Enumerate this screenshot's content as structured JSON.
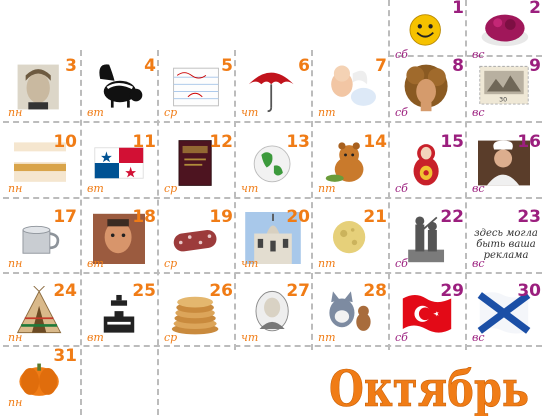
{
  "month": {
    "title": "Октябрь",
    "color": "#f07c16"
  },
  "colors": {
    "weekday": "#f07c16",
    "weekend": "#9b1f7e",
    "grid": "#bcbcbc"
  },
  "ad_text": "здесь могла быть ваша реклама",
  "days": [
    {
      "day": "1",
      "dow": "сб",
      "icon": "smiley-icon"
    },
    {
      "day": "2",
      "dow": "вс",
      "icon": "beet-salad-icon"
    },
    {
      "day": "3",
      "dow": "пн",
      "icon": "poet-portrait-icon"
    },
    {
      "day": "4",
      "dow": "вт",
      "icon": "skunk-icon"
    },
    {
      "day": "5",
      "dow": "ср",
      "icon": "notebook-page-icon"
    },
    {
      "day": "6",
      "dow": "чт",
      "icon": "umbrella-icon"
    },
    {
      "day": "7",
      "dow": "пт",
      "icon": "cherub-icon"
    },
    {
      "day": "8",
      "dow": "сб",
      "icon": "curly-hair-woman-icon"
    },
    {
      "day": "9",
      "dow": "вс",
      "icon": "postage-stamp-icon"
    },
    {
      "day": "10",
      "dow": "пн",
      "icon": "medicine-bottle-icon"
    },
    {
      "day": "11",
      "dow": "вт",
      "icon": "panama-flag-icon"
    },
    {
      "day": "12",
      "dow": "ср",
      "icon": "labor-book-icon"
    },
    {
      "day": "13",
      "dow": "чт",
      "icon": "globe-icon"
    },
    {
      "day": "14",
      "dow": "пт",
      "icon": "winnie-the-pooh-icon"
    },
    {
      "day": "15",
      "dow": "сб",
      "icon": "matryoshka-doll-icon"
    },
    {
      "day": "16",
      "dow": "вс",
      "icon": "chef-icon"
    },
    {
      "day": "17",
      "dow": "пн",
      "icon": "tin-mug-icon"
    },
    {
      "day": "18",
      "dow": "вт",
      "icon": "man-portrait-icon"
    },
    {
      "day": "19",
      "dow": "ср",
      "icon": "salami-icon"
    },
    {
      "day": "20",
      "dow": "чт",
      "icon": "cathedral-icon"
    },
    {
      "day": "21",
      "dow": "пт",
      "icon": "moon-icon"
    },
    {
      "day": "22",
      "dow": "сб",
      "icon": "monument-icon"
    },
    {
      "day": "23",
      "dow": "вс",
      "icon": "ad-text"
    },
    {
      "day": "24",
      "dow": "пн",
      "icon": "teepee-icon"
    },
    {
      "day": "25",
      "dow": "вт",
      "icon": "customs-officer-icon"
    },
    {
      "day": "26",
      "dow": "ср",
      "icon": "pancake-stack-icon"
    },
    {
      "day": "27",
      "dow": "чт",
      "icon": "engraved-portrait-icon"
    },
    {
      "day": "28",
      "dow": "пт",
      "icon": "tom-and-jerry-icon"
    },
    {
      "day": "29",
      "dow": "сб",
      "icon": "turkey-flag-icon"
    },
    {
      "day": "30",
      "dow": "вс",
      "icon": "navy-flag-icon"
    },
    {
      "day": "31",
      "dow": "пн",
      "icon": "pumpkin-icon"
    }
  ]
}
